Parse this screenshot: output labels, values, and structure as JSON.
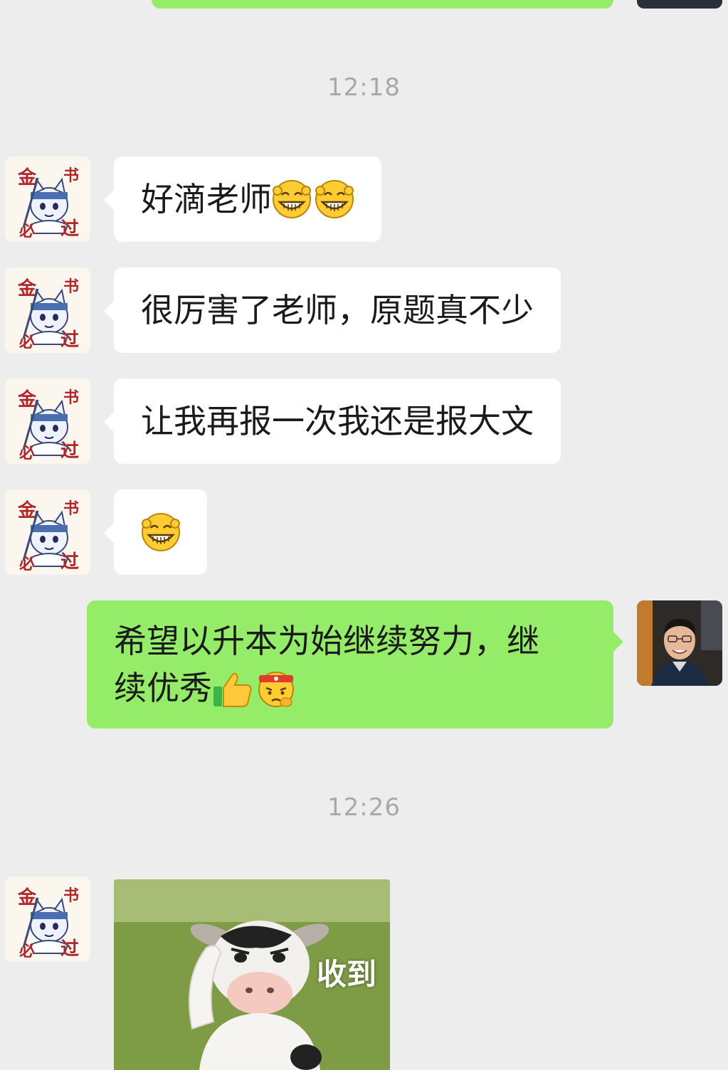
{
  "timestamps": [
    "12:18",
    "12:26"
  ],
  "messages": [
    {
      "side": "left",
      "text": "好滴老师",
      "emojis": [
        "grin-emoji",
        "grin-emoji"
      ]
    },
    {
      "side": "left",
      "text": "很厉害了老师，原题真不少"
    },
    {
      "side": "left",
      "text": "让我再报一次我还是报大文"
    },
    {
      "side": "left",
      "text": "",
      "emojis": [
        "grin-emoji"
      ]
    },
    {
      "side": "right",
      "text_line1": "希望以升本为始继续努力，继",
      "text_line2": "续优秀",
      "emojis": [
        "thumbs-up-emoji",
        "determined-headband-emoji"
      ]
    }
  ],
  "sticker": {
    "caption": "收到"
  },
  "avatars": {
    "left_logo_chars": [
      "金",
      "必",
      "过",
      "书"
    ]
  },
  "colors": {
    "background": "#ededed",
    "incoming_bubble": "#ffffff",
    "outgoing_bubble": "#95ec69",
    "timestamp": "#a8a8a8"
  }
}
